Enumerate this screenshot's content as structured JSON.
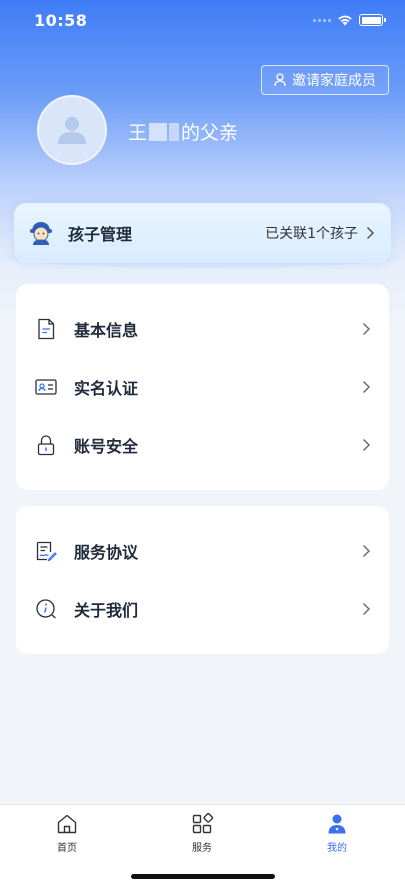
{
  "status_bar": {
    "time": "10:58"
  },
  "header": {
    "invite_label": "邀请家庭成员",
    "user_name_prefix": "王",
    "user_name_suffix": "的父亲"
  },
  "child_card": {
    "title": "孩子管理",
    "status": "已关联1个孩子"
  },
  "menu_group_1": [
    {
      "label": "基本信息",
      "icon": "document-icon"
    },
    {
      "label": "实名认证",
      "icon": "id-card-icon"
    },
    {
      "label": "账号安全",
      "icon": "lock-icon"
    }
  ],
  "menu_group_2": [
    {
      "label": "服务协议",
      "icon": "signed-document-icon"
    },
    {
      "label": "关于我们",
      "icon": "info-icon"
    }
  ],
  "tab_bar": {
    "tabs": [
      {
        "label": "首页",
        "icon": "home-icon",
        "active": false
      },
      {
        "label": "服务",
        "icon": "grid-icon",
        "active": false
      },
      {
        "label": "我的",
        "icon": "profile-icon",
        "active": true
      }
    ]
  },
  "colors": {
    "accent": "#3a6ff0",
    "hero_top": "#3f7cf6"
  }
}
